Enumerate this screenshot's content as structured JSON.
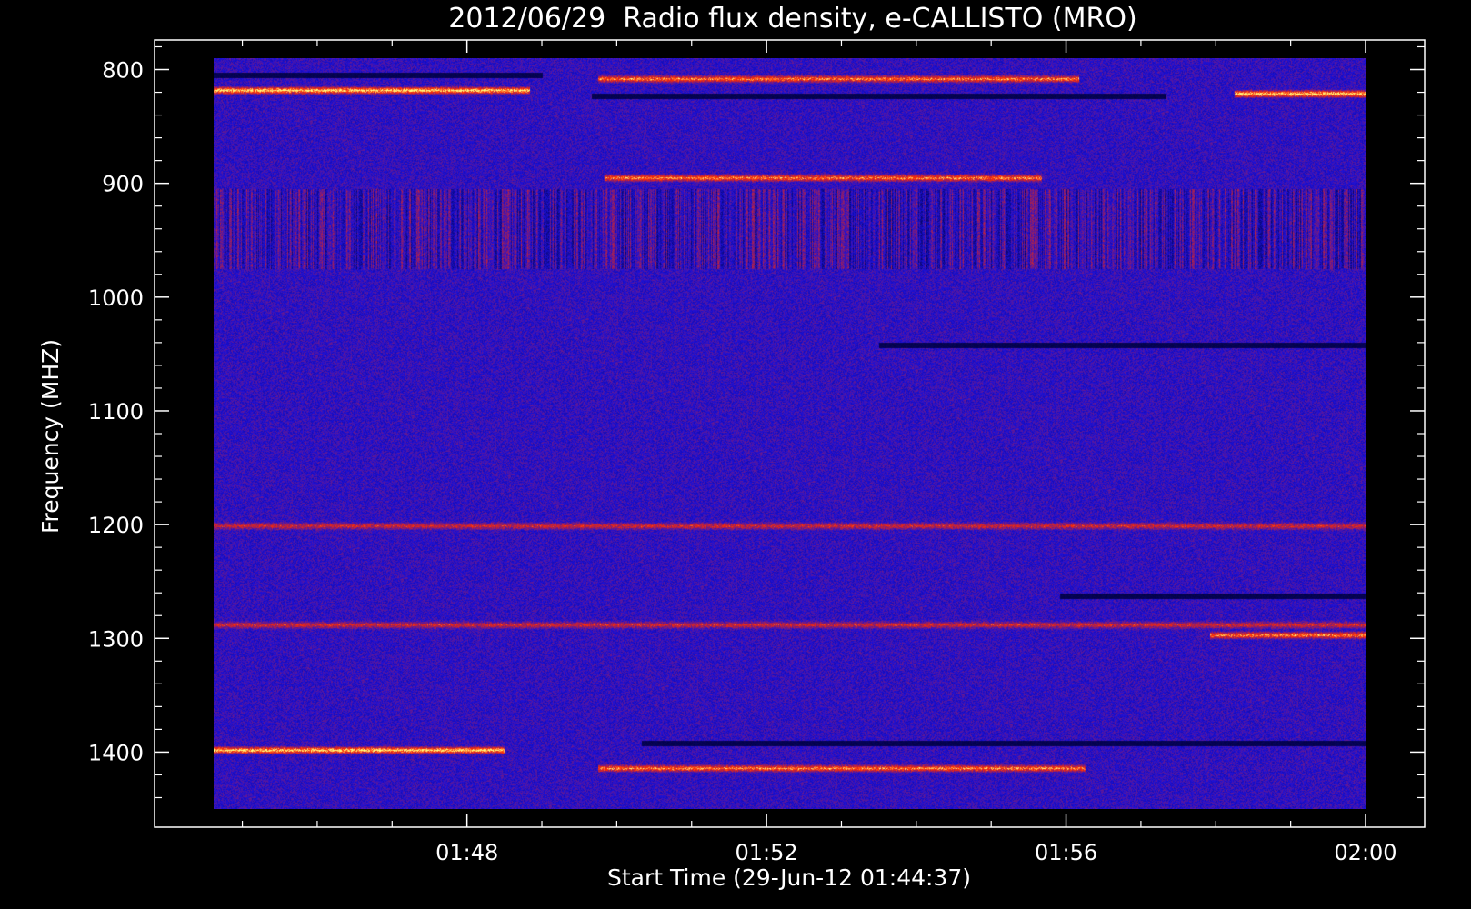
{
  "chart_data": {
    "type": "heatmap",
    "title": "2012/06/29  Radio flux density, e-CALLISTO (MRO)",
    "xlabel": "Start Time (29-Jun-12 01:44:37)",
    "ylabel": "Frequency (MHZ)",
    "start_time": "01:44:37",
    "end_time": "02:00:00",
    "x_ticks": [
      {
        "label": "01:48",
        "time": "01:48:00"
      },
      {
        "label": "01:52",
        "time": "01:52:00"
      },
      {
        "label": "01:56",
        "time": "01:56:00"
      },
      {
        "label": "02:00",
        "time": "02:00:00"
      }
    ],
    "y_ticks": [
      {
        "label": "800",
        "value": 800
      },
      {
        "label": "900",
        "value": 900
      },
      {
        "label": "1000",
        "value": 1000
      },
      {
        "label": "1100",
        "value": 1100
      },
      {
        "label": "1200",
        "value": 1200
      },
      {
        "label": "1300",
        "value": 1300
      },
      {
        "label": "1400",
        "value": 1400
      }
    ],
    "ylim": [
      1450,
      790
    ],
    "y_axis_inverted": true,
    "colormap": {
      "background": "#000000",
      "low": "#000033",
      "mid": "#1a10d8",
      "high": "#ff2a00",
      "peak": "#ffff80"
    },
    "emission_bands": [
      {
        "freq_mhz": 808,
        "start": "01:49:45",
        "end": "01:56:10",
        "intensity": "high"
      },
      {
        "freq_mhz": 818,
        "start": "01:44:37",
        "end": "01:48:50",
        "intensity": "peak"
      },
      {
        "freq_mhz": 821,
        "start": "01:58:15",
        "end": "02:00:00",
        "intensity": "peak"
      },
      {
        "freq_mhz": 895,
        "start": "01:49:50",
        "end": "01:55:40",
        "intensity": "high"
      },
      {
        "freq_mhz": 1201,
        "start": "01:44:37",
        "end": "02:00:00",
        "intensity": "medium"
      },
      {
        "freq_mhz": 1288,
        "start": "01:44:37",
        "end": "02:00:00",
        "intensity": "medium"
      },
      {
        "freq_mhz": 1297,
        "start": "01:57:55",
        "end": "02:00:00",
        "intensity": "high"
      },
      {
        "freq_mhz": 1398,
        "start": "01:44:37",
        "end": "01:48:30",
        "intensity": "peak"
      },
      {
        "freq_mhz": 1414,
        "start": "01:49:45",
        "end": "01:56:15",
        "intensity": "high"
      }
    ],
    "dark_bands": [
      {
        "freq_mhz": 805,
        "start": "01:44:37",
        "end": "01:49:00"
      },
      {
        "freq_mhz": 823,
        "start": "01:49:40",
        "end": "01:57:20"
      },
      {
        "freq_mhz": 1263,
        "start": "01:55:55",
        "end": "02:00:00"
      },
      {
        "freq_mhz": 1392,
        "start": "01:50:20",
        "end": "02:00:00"
      },
      {
        "freq_mhz": 1042,
        "start": "01:53:30",
        "end": "02:00:00"
      }
    ],
    "grid": false,
    "legend": "none"
  }
}
